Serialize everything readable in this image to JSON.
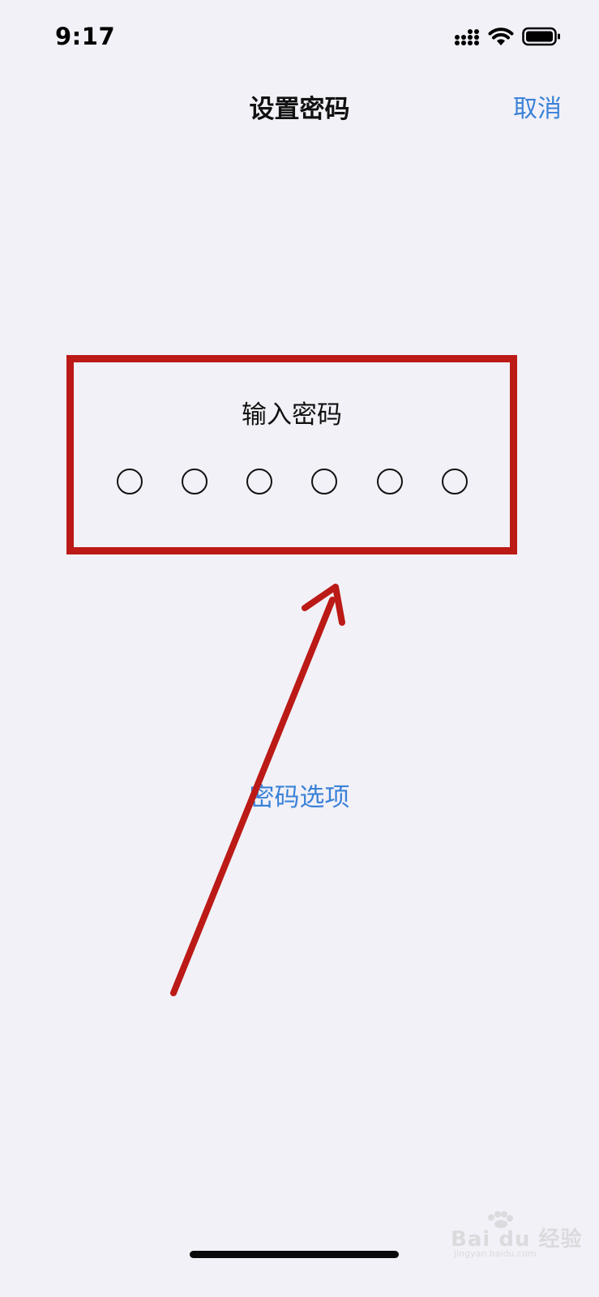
{
  "status_bar": {
    "time": "9:17",
    "icons": [
      "cellular-signal-icon",
      "wifi-icon",
      "battery-icon"
    ]
  },
  "nav": {
    "title": "设置密码",
    "cancel_label": "取消"
  },
  "passcode": {
    "prompt": "输入密码",
    "digit_count": 6,
    "filled_count": 0
  },
  "options_link": "密码选项",
  "watermark": {
    "brand": "Bai du 经验",
    "domain": "jingyan.baidu.com"
  },
  "colors": {
    "background": "#f2f1f7",
    "accent": "#3b82d8",
    "annotation": "#bb1a16"
  }
}
